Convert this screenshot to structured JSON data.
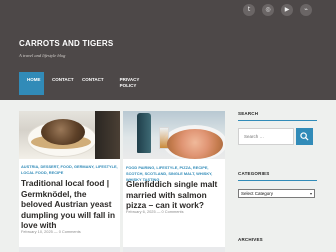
{
  "header": {
    "site_title": "CARROTS AND TIGERS",
    "tagline": "A travel and lifestyle blog",
    "social": [
      "twitter-icon",
      "instagram-icon",
      "youtube-icon",
      "rss-icon"
    ]
  },
  "nav": {
    "items": [
      {
        "label": "HOME",
        "active": true
      },
      {
        "label": "CONTACT",
        "active": false
      },
      {
        "label": "CONTACT",
        "active": false
      },
      {
        "label": "PRIVACY POLICY",
        "active": false
      }
    ]
  },
  "posts": [
    {
      "categories": "AUSTRIA, DESSERT, FOOD, GERMANY, LIFESTYLE, LOCAL FOOD, RECIPE",
      "title": "Traditional local food | Germknödel, the beloved Austrian yeast dumpling you will fall in love with",
      "date": "February 10, 2025",
      "comments": "0 Comments"
    },
    {
      "categories": "FOOD PAIRING, LIFESTYLE, PIZZA, RECIPE, SCOTCH, SCOTLAND, SINGLE MALT, WHISKY, WHISKY TASTING",
      "title": "Glenfiddich single malt married with salmon pizza – can it work?",
      "date": "February 6, 2025",
      "comments": "0 Comments"
    }
  ],
  "sidebar": {
    "search_title": "SEARCH",
    "search_placeholder": "Search …",
    "categories_title": "CATEGORIES",
    "categories_select": "Select Category",
    "archives_title": "ARCHIVES"
  },
  "colors": {
    "header_bg": "#4d4848",
    "accent": "#318bb8",
    "page_bg": "#eef0ee"
  }
}
